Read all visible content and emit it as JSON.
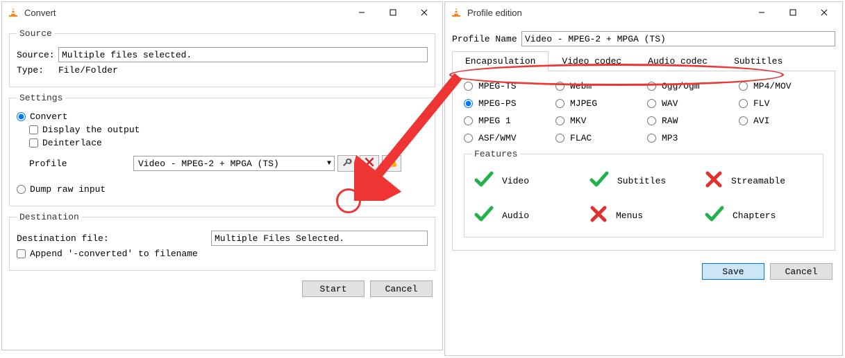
{
  "convert_window": {
    "title": "Convert",
    "source_group": "Source",
    "source_label": "Source:",
    "source_value": "Multiple files selected.",
    "type_label": "Type:",
    "type_value": "File/Folder",
    "settings_group": "Settings",
    "convert_radio": "Convert",
    "display_output_check": "Display the output",
    "deinterlace_check": "Deinterlace",
    "profile_label": "Profile",
    "profile_selected": "Video - MPEG-2 + MPGA (TS)",
    "dump_radio": "Dump raw input",
    "destination_group": "Destination",
    "dest_file_label": "Destination file:",
    "dest_file_value": "Multiple Files Selected.",
    "append_check": "Append '-converted' to filename",
    "start_btn": "Start",
    "cancel_btn": "Cancel"
  },
  "profile_window": {
    "title": "Profile edition",
    "name_label": "Profile Name",
    "name_value": "Video - MPEG-2 + MPGA (TS)",
    "tabs": {
      "encapsulation": "Encapsulation",
      "video_codec": "Video codec",
      "audio_codec": "Audio codec",
      "subtitles": "Subtitles"
    },
    "encaps": {
      "mpeg_ts": "MPEG-TS",
      "webm": "Webm",
      "ogg": "Ogg/Ogm",
      "mp4": "MP4/MOV",
      "mpeg_ps": "MPEG-PS",
      "mjpeg": "MJPEG",
      "wav": "WAV",
      "flv": "FLV",
      "mpeg1": "MPEG 1",
      "mkv": "MKV",
      "raw": "RAW",
      "avi": "AVI",
      "asf": "ASF/WMV",
      "flac": "FLAC",
      "mp3": "MP3"
    },
    "encaps_selected": "mpeg_ps",
    "features_group": "Features",
    "features": {
      "video": {
        "label": "Video",
        "ok": true
      },
      "subtitles": {
        "label": "Subtitles",
        "ok": true
      },
      "streamable": {
        "label": "Streamable",
        "ok": false
      },
      "audio": {
        "label": "Audio",
        "ok": true
      },
      "menus": {
        "label": "Menus",
        "ok": false
      },
      "chapters": {
        "label": "Chapters",
        "ok": true
      }
    },
    "save_btn": "Save",
    "cancel_btn": "Cancel"
  },
  "icons": {
    "wrench": "wrench-icon",
    "delete": "delete-icon",
    "newprofile": "new-profile-icon"
  }
}
